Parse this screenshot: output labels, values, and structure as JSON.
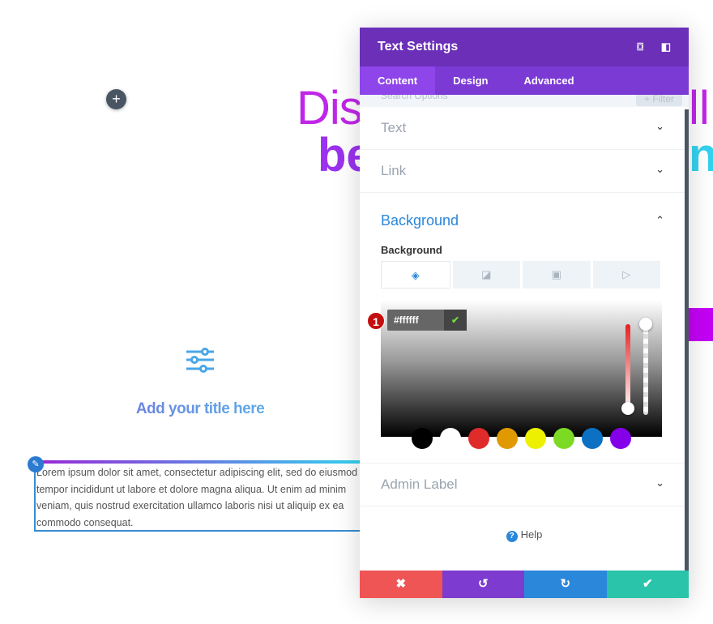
{
  "canvas": {
    "heading_line1_left": "Dis",
    "heading_line1_right": "ll",
    "heading_line2_left": "be",
    "heading_line2_right": "nt",
    "blurb_title": "Add your title here",
    "body_text": "Lorem ipsum dolor sit amet, consectetur adipiscing elit, sed do eiusmod tempor incididunt ut labore et dolore magna aliqua. Ut enim ad minim veniam, quis nostrud exercitation ullamco laboris nisi ut aliquip ex ea commodo consequat."
  },
  "panel": {
    "title": "Text Settings",
    "tabs": [
      {
        "label": "Content",
        "active": true
      },
      {
        "label": "Design"
      },
      {
        "label": "Advanced"
      }
    ],
    "search_placeholder": "Search Options",
    "filter_label": "+ Filter",
    "sections": {
      "text": "Text",
      "link": "Link",
      "background": "Background",
      "admin_label": "Admin Label"
    },
    "background": {
      "label": "Background",
      "types": [
        "color",
        "gradient",
        "image",
        "video"
      ],
      "hex_value": "#ffffff",
      "step_badge": "1",
      "swatches": [
        "#000000",
        "#ffffff",
        "#e02b2b",
        "#e09900",
        "#edf000",
        "#7cda24",
        "#0c71c3",
        "#8300e9"
      ]
    },
    "help": "Help"
  },
  "colors": {
    "header": "#6b2fb8",
    "tabs": "#7b3ad4",
    "cancel": "#ef5555",
    "undo": "#7d3bcf",
    "redo": "#2b87da",
    "save": "#29c4a9"
  }
}
